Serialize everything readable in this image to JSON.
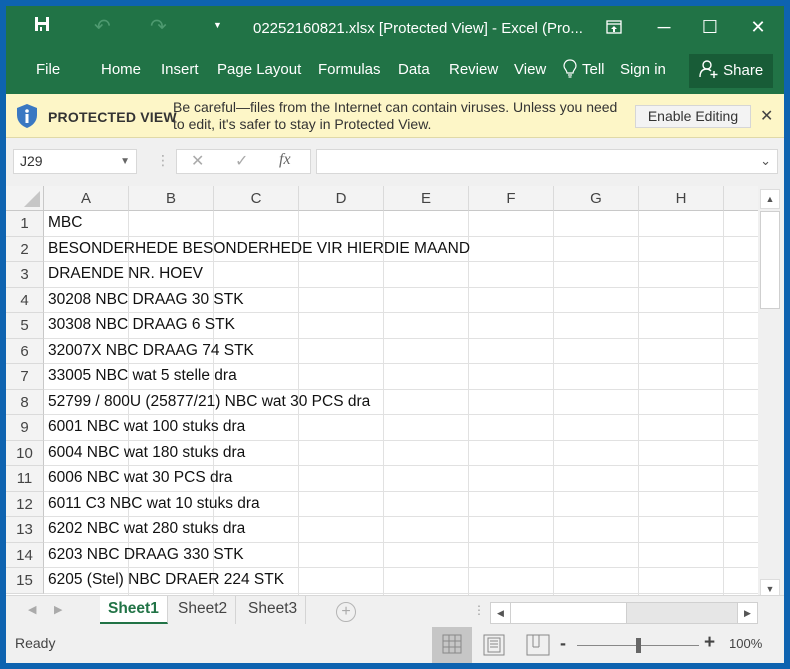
{
  "app": {
    "title": "02252160821.xlsx  [Protected View] - Excel (Pro..."
  },
  "quick_access": {
    "save_icon": "floppy-disk-icon",
    "undo_icon": "undo-icon",
    "redo_icon": "redo-icon",
    "customize_icon": "dropdown-icon"
  },
  "window_controls": {
    "ribbon_display": "⊡",
    "minimize": "─",
    "maximize": "☐",
    "close": "✕"
  },
  "ribbon": {
    "tabs": [
      "File",
      "Home",
      "Insert",
      "Page Layout",
      "Formulas",
      "Data",
      "Review",
      "View"
    ],
    "tell_label": "Tell",
    "sign_in": "Sign in",
    "share": "Share"
  },
  "protected_view": {
    "title": "PROTECTED VIEW",
    "message": "Be careful—files from the Internet can contain viruses. Unless you need to edit, it's safer to stay in Protected View.",
    "enable_button": "Enable Editing",
    "close": "✕"
  },
  "formula_bar": {
    "name_box": "J29",
    "cancel": "✕",
    "enter": "✓",
    "fx": "fx",
    "formula": ""
  },
  "sheet": {
    "columns": [
      "A",
      "B",
      "C",
      "D",
      "E",
      "F",
      "G",
      "H"
    ],
    "rows": [
      {
        "num": "1",
        "a": "MBC"
      },
      {
        "num": "2",
        "a": "BESONDERHEDE BESONDERHEDE VIR HIERDIE MAAND"
      },
      {
        "num": "3",
        "a": "DRAENDE NR. HOEV"
      },
      {
        "num": "4",
        "a": "30208 NBC DRAAG 30 STK"
      },
      {
        "num": "5",
        "a": "30308 NBC DRAAG 6 STK"
      },
      {
        "num": "6",
        "a": "32007X NBC DRAAG 74 STK"
      },
      {
        "num": "7",
        "a": "33005 NBC wat 5 stelle dra"
      },
      {
        "num": "8",
        "a": "52799 / 800U (25877/21) NBC wat 30 PCS dra"
      },
      {
        "num": "9",
        "a": "6001 NBC wat 100 stuks dra"
      },
      {
        "num": "10",
        "a": "6004 NBC wat 180 stuks dra"
      },
      {
        "num": "11",
        "a": "6006 NBC wat 30 PCS dra"
      },
      {
        "num": "12",
        "a": "6011 C3 NBC wat 10 stuks dra"
      },
      {
        "num": "13",
        "a": "6202 NBC wat 280 stuks dra"
      },
      {
        "num": "14",
        "a": "6203 NBC DRAAG 330 STK"
      },
      {
        "num": "15",
        "a": "6205 (Stel) NBC DRAER 224 STK"
      }
    ]
  },
  "sheet_tabs": {
    "tabs": [
      "Sheet1",
      "Sheet2",
      "Sheet3"
    ],
    "active": "Sheet1",
    "add": "+"
  },
  "status_bar": {
    "status": "Ready",
    "zoom_level": "100%",
    "zoom_percent": 100,
    "zoom_minus": "-",
    "zoom_plus": "+"
  },
  "colors": {
    "excel_green": "#217346",
    "share_green": "#185c37",
    "protected_bar": "#fdf6c7",
    "shield_blue": "#3a78c2"
  }
}
